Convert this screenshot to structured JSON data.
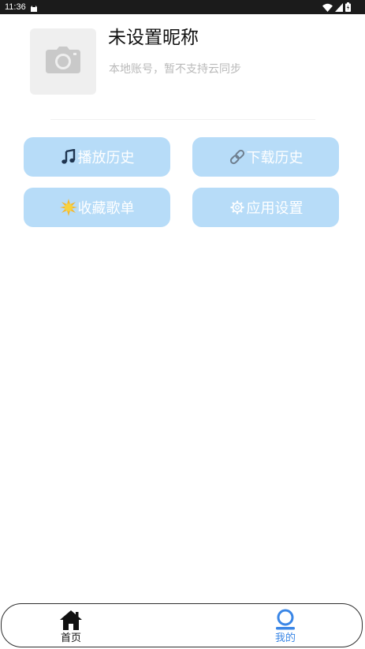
{
  "status_bar": {
    "time": "11:36"
  },
  "profile": {
    "nickname": "未设置昵称",
    "account_note": "本地账号，暂不支持云同步",
    "avatar_icon": "camera-icon"
  },
  "actions": [
    {
      "label": "播放历史",
      "icon": "music-note-icon"
    },
    {
      "label": "下载历史",
      "icon": "link-icon"
    },
    {
      "label": "收藏歌单",
      "icon": "sun-icon"
    },
    {
      "label": "应用设置",
      "icon": "gear-icon"
    }
  ],
  "bottom_nav": {
    "home_label": "首页",
    "mine_label": "我的",
    "active": "mine"
  },
  "colors": {
    "button_bg": "#b7dcf8",
    "active_tab": "#3a86e6",
    "status_bar_bg": "#1b1b1b"
  }
}
